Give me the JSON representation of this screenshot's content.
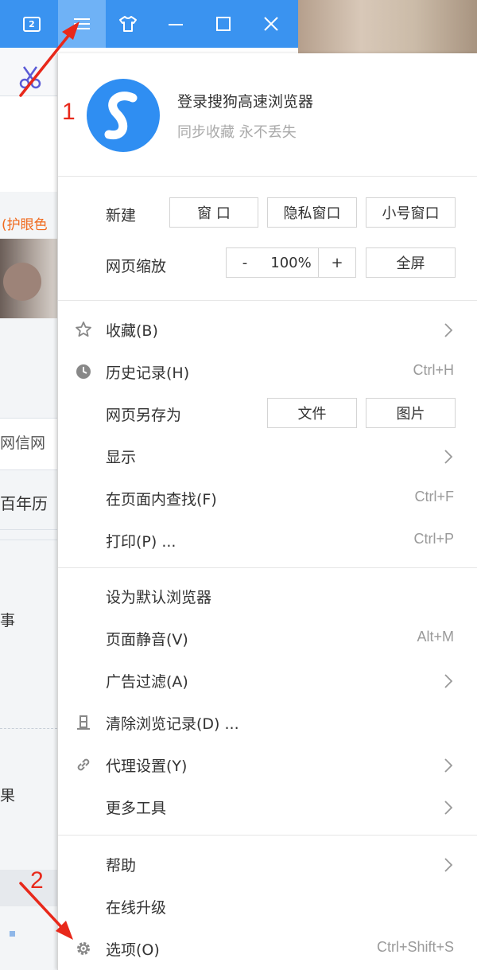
{
  "titlebar": {
    "tab_count": "2",
    "menu_icon": "hamburger-menu-icon",
    "skin_icon": "tshirt-skin-icon",
    "minimize_icon": "minimize-icon",
    "maximize_icon": "maximize-icon",
    "close_icon": "close-icon",
    "accent_color": "#3a93f0"
  },
  "background_page": {
    "text_eye_mode": "(护眼色",
    "text_netease": "网信网",
    "text_calendar": "百年历",
    "text_fragment1": "事",
    "text_fragment2": "果"
  },
  "menu": {
    "login": {
      "title": "登录搜狗高速浏览器",
      "subtitle": "同步收藏 永不丢失"
    },
    "new": {
      "label": "新建",
      "window": "窗 口",
      "private_window": "隐私窗口",
      "small_window": "小号窗口"
    },
    "zoom": {
      "label": "网页缩放",
      "minus": "-",
      "value": "100%",
      "plus": "+",
      "fullscreen": "全屏"
    },
    "group1": {
      "bookmarks": "收藏(B)",
      "history": "历史记录(H)",
      "history_shortcut": "Ctrl+H",
      "save_as": "网页另存为",
      "save_file": "文件",
      "save_image": "图片",
      "display": "显示",
      "find": "在页面内查找(F)",
      "find_shortcut": "Ctrl+F",
      "print": "打印(P) ...",
      "print_shortcut": "Ctrl+P"
    },
    "group2": {
      "default_browser": "设为默认浏览器",
      "mute": "页面静音(V)",
      "mute_shortcut": "Alt+M",
      "adblock": "广告过滤(A)",
      "clear_history": "清除浏览记录(D) ...",
      "proxy": "代理设置(Y)",
      "more_tools": "更多工具"
    },
    "group3": {
      "help": "帮助",
      "upgrade": "在线升级",
      "options": "选项(O)",
      "options_shortcut": "Ctrl+Shift+S"
    }
  },
  "annotations": {
    "step1": "1",
    "step2": "2",
    "color": "#e8281a"
  }
}
